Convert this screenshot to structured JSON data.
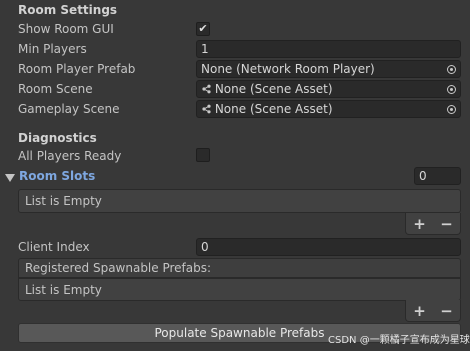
{
  "room_settings": {
    "header": "Room Settings",
    "show_room_gui_label": "Show Room GUI",
    "show_room_gui_check": "✔",
    "min_players_label": "Min Players",
    "min_players_value": "1",
    "room_player_prefab_label": "Room Player Prefab",
    "room_player_prefab_value": "None (Network Room Player)",
    "room_scene_label": "Room Scene",
    "room_scene_value": "None (Scene Asset)",
    "gameplay_scene_label": "Gameplay Scene",
    "gameplay_scene_value": "None (Scene Asset)"
  },
  "diagnostics": {
    "header": "Diagnostics",
    "all_players_ready_label": "All Players Ready",
    "room_slots_label": "Room Slots",
    "room_slots_count": "0",
    "room_slots_empty": "List is Empty"
  },
  "client_index": {
    "label": "Client Index",
    "value": "0"
  },
  "registered_prefabs": {
    "header": "Registered Spawnable Prefabs:",
    "empty": "List is Empty"
  },
  "list_controls": {
    "add": "+",
    "remove": "−"
  },
  "populate_button_label": "Populate Spawnable Prefabs",
  "watermark": "CSDN @一颗橘子宣布成为星球",
  "icons": {
    "collapse": "triangle-down-icon",
    "object_picker": "object-picker-icon",
    "scene_asset": "scene-asset-icon"
  }
}
